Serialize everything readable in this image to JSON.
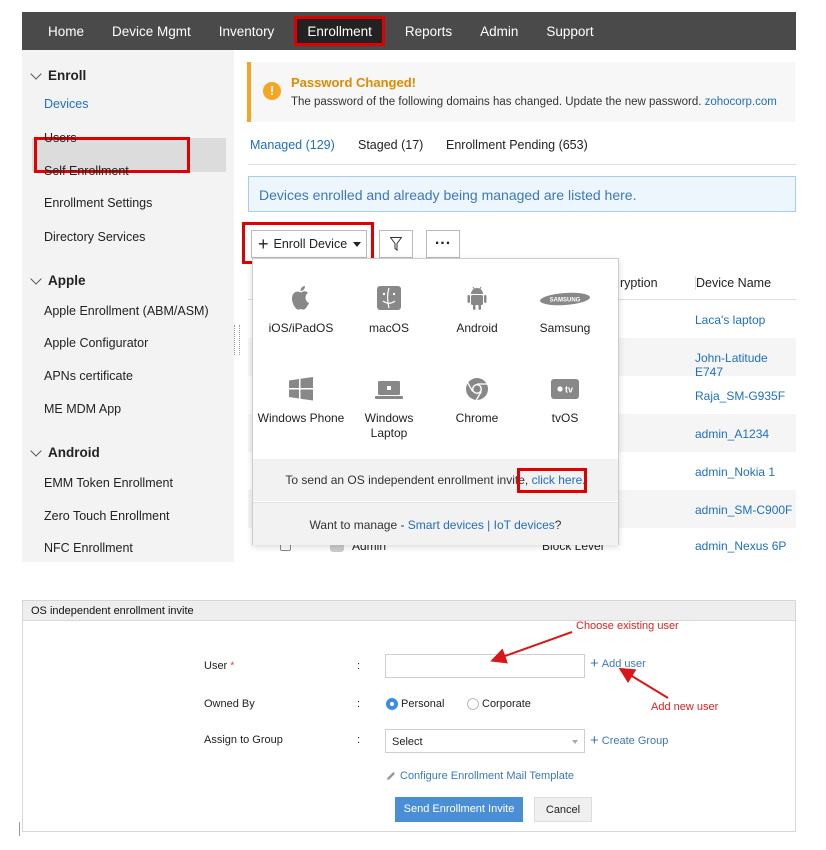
{
  "nav": {
    "items": [
      "Home",
      "Device Mgmt",
      "Inventory",
      "Enrollment",
      "Reports",
      "Admin",
      "Support"
    ],
    "active": "Enrollment"
  },
  "sidebar": {
    "enroll": {
      "title": "Enroll",
      "items": [
        "Devices",
        "Users",
        "Self Enrollment",
        "Enrollment Settings",
        "Directory Services"
      ]
    },
    "apple": {
      "title": "Apple",
      "items": [
        "Apple Enrollment (ABM/ASM)",
        "Apple Configurator",
        "APNs certificate",
        "ME MDM App"
      ]
    },
    "android": {
      "title": "Android",
      "items": [
        "EMM Token Enrollment",
        "Zero Touch Enrollment",
        "NFC Enrollment"
      ]
    }
  },
  "alert": {
    "title": "Password Changed!",
    "text": "The password of the following domains has changed. Update the new password.",
    "link": "zohocorp.com",
    "icon_text": "!"
  },
  "tabs": [
    "Managed (129)",
    "Staged (17)",
    "Enrollment Pending (653)"
  ],
  "info_bar": "Devices enrolled and already being managed are listed here.",
  "toolbar": {
    "enroll_label": "Enroll Device"
  },
  "table": {
    "col_encryption": "ryption",
    "col_device_name": "Device Name",
    "device_names": [
      "Laca's laptop",
      "John-Latitude E747",
      "Raja_SM-G935F",
      "admin_A1234",
      "admin_Nokia 1",
      "admin_SM-C900F",
      "admin_Nexus 6P"
    ],
    "last_row_user": "Admin",
    "last_row_encryption": "Block Level"
  },
  "dropdown": {
    "os": [
      {
        "label": "iOS/iPadOS",
        "icon": "apple-icon"
      },
      {
        "label": "macOS",
        "icon": "finder-icon"
      },
      {
        "label": "Android",
        "icon": "android-icon"
      },
      {
        "label": "Samsung",
        "icon": "samsung-icon"
      },
      {
        "label": "Windows Phone",
        "icon": "windows-icon"
      },
      {
        "label": "Windows Laptop",
        "icon": "laptop-icon"
      },
      {
        "label": "Chrome",
        "icon": "chrome-icon"
      },
      {
        "label": "tvOS",
        "icon": "appletv-icon"
      }
    ],
    "invite_prefix": "To send an OS independent enrollment invite,",
    "invite_link": "click here",
    "invite_suffix": ".",
    "manage_prefix": "Want to manage -",
    "smart_devices": "Smart devices",
    "separator": "|",
    "iot_devices": "IoT devices",
    "manage_suffix": "?",
    "samsung_logo_text": "SAMSUNG",
    "tv_logo_text": "tv"
  },
  "form": {
    "header": "OS independent enrollment invite",
    "user_label": "User",
    "required_mark": "*",
    "owned_by_label": "Owned By",
    "group_label": "Assign to Group",
    "colon": ":",
    "add_user": "Add user",
    "personal": "Personal",
    "corporate": "Corporate",
    "group_select": "Select",
    "create_group": "Create Group",
    "config_mail": "Configure Enrollment Mail Template",
    "send": "Send Enrollment Invite",
    "cancel": "Cancel"
  },
  "annotations": {
    "choose_user": "Choose existing user",
    "add_new_user": "Add new user"
  },
  "colors": {
    "accent_blue": "#1f6fbf",
    "highlight_red": "#e00000",
    "alert_orange": "#f5a623",
    "nav_bg": "#4a4a4a"
  }
}
